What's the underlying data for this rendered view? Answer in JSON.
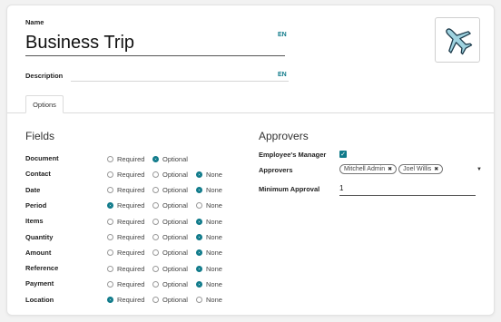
{
  "form": {
    "name_label": "Name",
    "name_value": "Business Trip",
    "lang_badge": "EN",
    "description_label": "Description",
    "description_value": "",
    "description_lang_badge": "EN",
    "avatar_icon": "airplane-icon"
  },
  "tabs": [
    {
      "label": "Options",
      "active": true
    }
  ],
  "fields_section": {
    "title": "Fields",
    "option_labels": {
      "required": "Required",
      "optional": "Optional",
      "none": "None"
    },
    "rows": [
      {
        "label": "Document",
        "selected": "optional",
        "has_none": false
      },
      {
        "label": "Contact",
        "selected": "none",
        "has_none": true
      },
      {
        "label": "Date",
        "selected": "none",
        "has_none": true
      },
      {
        "label": "Period",
        "selected": "required",
        "has_none": true
      },
      {
        "label": "Items",
        "selected": "none",
        "has_none": true
      },
      {
        "label": "Quantity",
        "selected": "none",
        "has_none": true
      },
      {
        "label": "Amount",
        "selected": "none",
        "has_none": true
      },
      {
        "label": "Reference",
        "selected": "none",
        "has_none": true
      },
      {
        "label": "Payment",
        "selected": "none",
        "has_none": true
      },
      {
        "label": "Location",
        "selected": "required",
        "has_none": true
      }
    ]
  },
  "approvers_section": {
    "title": "Approvers",
    "employees_manager_label": "Employee's Manager",
    "employees_manager_checked": true,
    "approvers_label": "Approvers",
    "approvers": [
      "Mitchell Admin",
      "Joel Willis"
    ],
    "minimum_approval_label": "Minimum Approval",
    "minimum_approval_value": "1"
  },
  "colors": {
    "accent": "#0f7a8a"
  }
}
